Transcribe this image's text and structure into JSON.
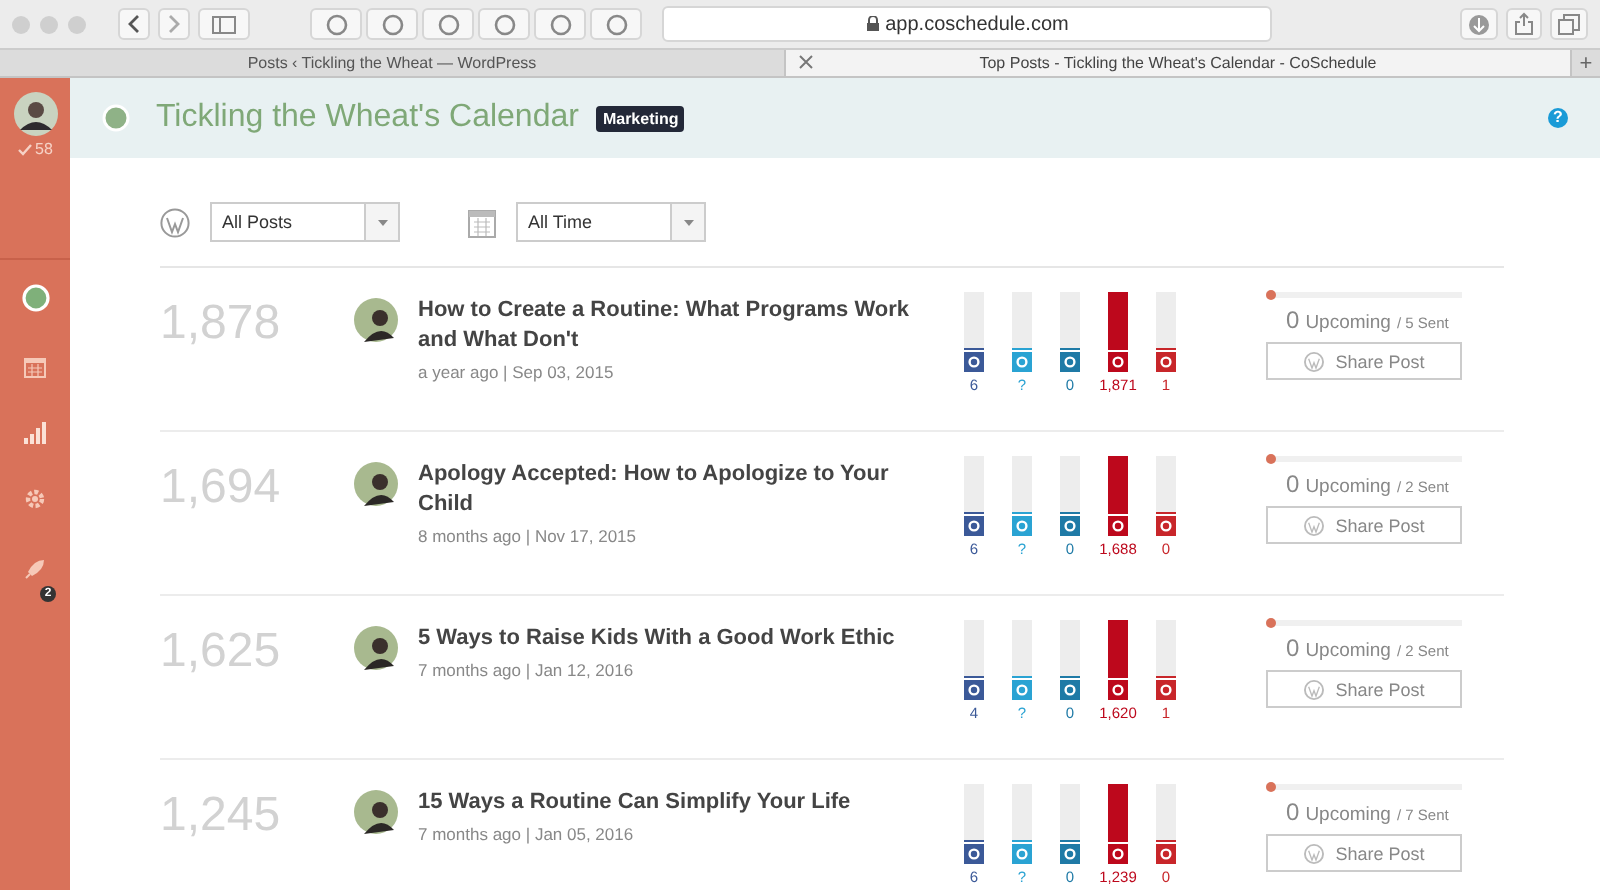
{
  "browser": {
    "url": "app.coschedule.com",
    "tabs": [
      {
        "title": "Posts ‹ Tickling the Wheat — WordPress",
        "selected": false
      },
      {
        "title": "Top Posts - Tickling the Wheat's Calendar - CoSchedule",
        "selected": true
      }
    ],
    "new_tab": "+"
  },
  "sidebar": {
    "count": "58",
    "badge": "2"
  },
  "header": {
    "title": "Tickling the Wheat's Calendar",
    "tag": "Marketing",
    "help": "?"
  },
  "filters": [
    {
      "kind": "posts",
      "value": "All Posts"
    },
    {
      "kind": "time",
      "value": "All Time"
    }
  ],
  "posts": [
    {
      "total": "1,878",
      "title": "How to Create a Routine: What Programs Work and What Don't",
      "meta": "a year ago | Sep 03, 2015",
      "upcoming": "0",
      "upcoming_label": "Upcoming",
      "sent": "/ 5 Sent",
      "level": 0,
      "share": "Share Post",
      "networks": [
        {
          "color": "#3b5998",
          "level": 0.05,
          "count": "6"
        },
        {
          "color": "#2aa3d3",
          "level": 0.05,
          "count": "?"
        },
        {
          "color": "#1f7aa6",
          "level": 0.05,
          "count": "0"
        },
        {
          "color": "#bd081c",
          "level": 1,
          "count": "1,871"
        },
        {
          "color": "#c8262a",
          "level": 0.05,
          "count": "1"
        }
      ]
    },
    {
      "total": "1,694",
      "title": "Apology Accepted: How to Apologize to Your Child",
      "meta": "8 months ago | Nov 17, 2015",
      "upcoming": "0",
      "upcoming_label": "Upcoming",
      "sent": "/ 2 Sent",
      "level": 0,
      "share": "Share Post",
      "networks": [
        {
          "color": "#3b5998",
          "level": 0.05,
          "count": "6"
        },
        {
          "color": "#2aa3d3",
          "level": 0.05,
          "count": "?"
        },
        {
          "color": "#1f7aa6",
          "level": 0.05,
          "count": "0"
        },
        {
          "color": "#bd081c",
          "level": 1,
          "count": "1,688"
        },
        {
          "color": "#c8262a",
          "level": 0.05,
          "count": "0"
        }
      ]
    },
    {
      "total": "1,625",
      "title": "5 Ways to Raise Kids With a Good Work Ethic",
      "meta": "7 months ago | Jan 12, 2016",
      "upcoming": "0",
      "upcoming_label": "Upcoming",
      "sent": "/ 2 Sent",
      "level": 0,
      "share": "Share Post",
      "networks": [
        {
          "color": "#3b5998",
          "level": 0.05,
          "count": "4"
        },
        {
          "color": "#2aa3d3",
          "level": 0.05,
          "count": "?"
        },
        {
          "color": "#1f7aa6",
          "level": 0.05,
          "count": "0"
        },
        {
          "color": "#bd081c",
          "level": 1,
          "count": "1,620"
        },
        {
          "color": "#c8262a",
          "level": 0.05,
          "count": "1"
        }
      ]
    },
    {
      "total": "1,245",
      "title": "15 Ways a Routine Can Simplify Your Life",
      "meta": "7 months ago | Jan 05, 2016",
      "upcoming": "0",
      "upcoming_label": "Upcoming",
      "sent": "/ 7 Sent",
      "level": 0,
      "share": "Share Post",
      "networks": [
        {
          "color": "#3b5998",
          "level": 0.05,
          "count": "6"
        },
        {
          "color": "#2aa3d3",
          "level": 0.05,
          "count": "?"
        },
        {
          "color": "#1f7aa6",
          "level": 0.05,
          "count": "0"
        },
        {
          "color": "#bd081c",
          "level": 1,
          "count": "1,239"
        },
        {
          "color": "#c8262a",
          "level": 0.05,
          "count": "0"
        }
      ]
    }
  ]
}
